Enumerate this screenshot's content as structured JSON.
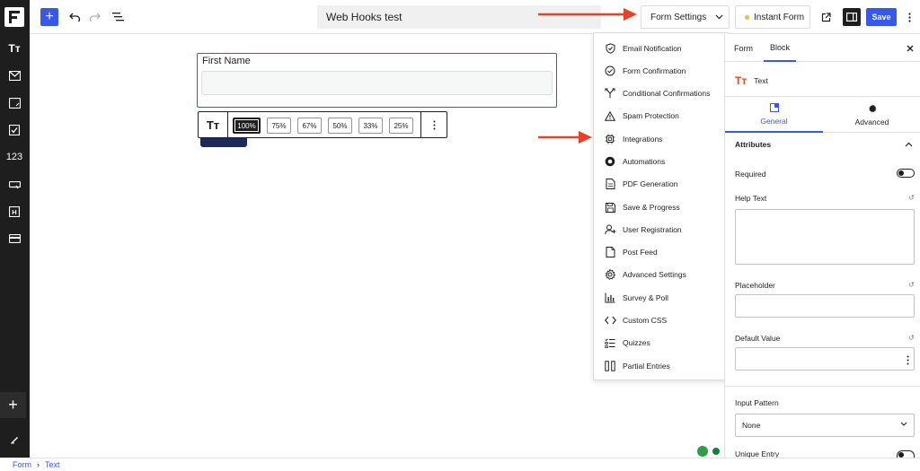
{
  "topbar": {
    "doc_title": "Web Hooks test",
    "form_settings_label": "Form Settings",
    "instant_form_label": "Instant Form",
    "save_label": "Save"
  },
  "leftbar": {
    "items": [
      {
        "icon": "text-type-icon",
        "glyph": "Tт"
      },
      {
        "icon": "mail-icon",
        "glyph": "✉"
      },
      {
        "icon": "textarea-icon",
        "glyph": "▭"
      },
      {
        "icon": "checkbox-icon",
        "glyph": "☑"
      },
      {
        "icon": "number-icon",
        "glyph": "123"
      },
      {
        "icon": "button-icon",
        "glyph": "⌐"
      },
      {
        "icon": "heading-icon",
        "glyph": "H"
      },
      {
        "icon": "payment-card-icon",
        "glyph": "▬"
      }
    ]
  },
  "canvas": {
    "field_label": "First Name",
    "width_options": [
      "100%",
      "75%",
      "67%",
      "50%",
      "33%",
      "25%"
    ],
    "active_width": "100%"
  },
  "dropdown": {
    "items": [
      {
        "label": "Email Notification",
        "icon": "shield-icon"
      },
      {
        "label": "Form Confirmation",
        "icon": "check-circle-icon"
      },
      {
        "label": "Conditional Confirmations",
        "icon": "branch-icon"
      },
      {
        "label": "Spam Protection",
        "icon": "warning-icon"
      },
      {
        "label": "Integrations",
        "icon": "chip-icon"
      },
      {
        "label": "Automations",
        "icon": "automation-icon"
      },
      {
        "label": "PDF Generation",
        "icon": "pdf-icon"
      },
      {
        "label": "Save & Progress",
        "icon": "floppy-icon"
      },
      {
        "label": "User Registration",
        "icon": "user-add-icon"
      },
      {
        "label": "Post Feed",
        "icon": "document-icon"
      },
      {
        "label": "Advanced Settings",
        "icon": "gear-icon"
      },
      {
        "label": "Survey & Poll",
        "icon": "bar-chart-icon"
      },
      {
        "label": "Custom CSS",
        "icon": "code-icon"
      },
      {
        "label": "Quizzes",
        "icon": "quiz-list-icon"
      },
      {
        "label": "Partial Entries",
        "icon": "columns-icon"
      }
    ]
  },
  "sidebar": {
    "tabs": [
      "Form",
      "Block"
    ],
    "active_tab": "Block",
    "block_name": "Text",
    "subtabs": [
      "General",
      "Advanced"
    ],
    "active_subtab": "General",
    "section_title": "Attributes",
    "required_label": "Required",
    "help_text_label": "Help Text",
    "placeholder_label": "Placeholder",
    "default_value_label": "Default Value",
    "input_pattern_label": "Input Pattern",
    "input_pattern_value": "None",
    "unique_entry_label": "Unique Entry"
  },
  "breadcrumb": {
    "items": [
      "Form",
      "Text"
    ]
  },
  "colors": {
    "accent": "#3858e9",
    "arrow": "#e8412a",
    "dark": "#1e1e1e"
  }
}
